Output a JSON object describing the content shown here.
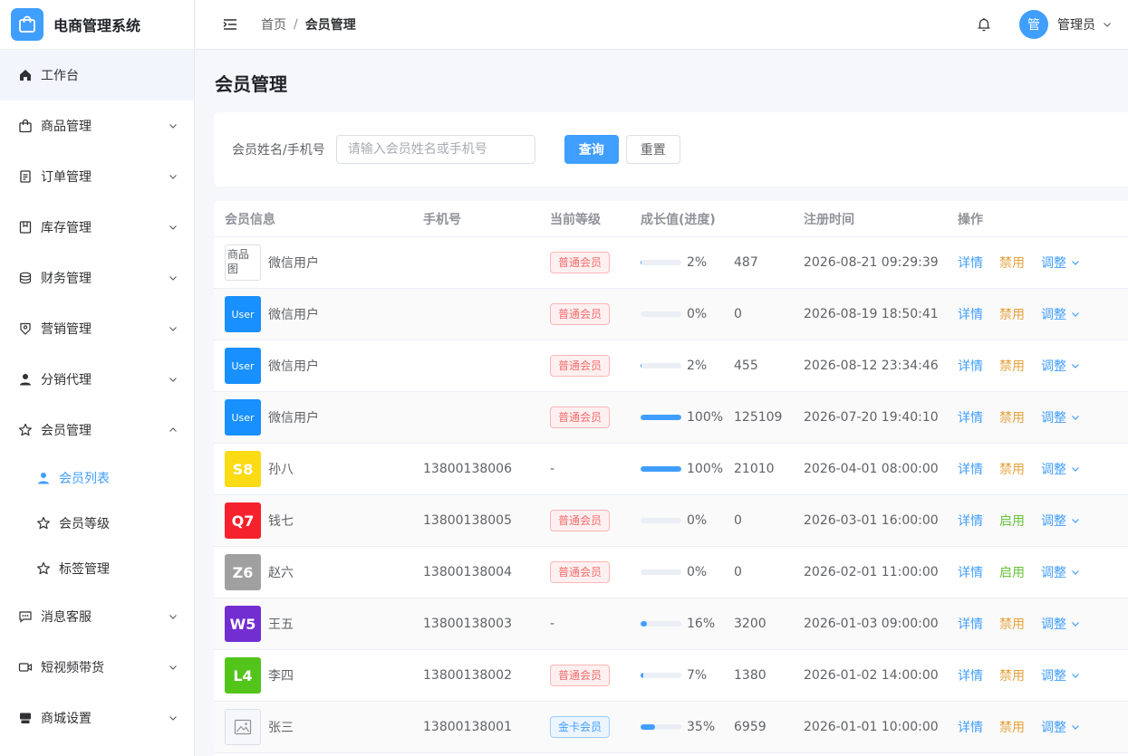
{
  "brand": {
    "title": "电商管理系统"
  },
  "colors": {
    "primary": "#409eff",
    "warning": "#e6a23c",
    "success": "#67c23a",
    "danger": "#f56c6c"
  },
  "sidebar": {
    "items": [
      {
        "label": "工作台",
        "icon": "home-icon"
      },
      {
        "label": "商品管理",
        "icon": "shopping-bag-icon"
      },
      {
        "label": "订单管理",
        "icon": "document-icon"
      },
      {
        "label": "库存管理",
        "icon": "box-icon"
      },
      {
        "label": "财务管理",
        "icon": "coins-icon"
      },
      {
        "label": "营销管理",
        "icon": "discount-icon"
      },
      {
        "label": "分销代理",
        "icon": "user-icon"
      },
      {
        "label": "会员管理",
        "icon": "star-icon"
      },
      {
        "label": "消息客服",
        "icon": "chat-icon"
      },
      {
        "label": "短视频带货",
        "icon": "video-icon"
      },
      {
        "label": "商城设置",
        "icon": "shop-icon"
      }
    ],
    "member_sub": [
      {
        "label": "会员列表",
        "icon": "user-icon"
      },
      {
        "label": "会员等级",
        "icon": "star-icon"
      },
      {
        "label": "标签管理",
        "icon": "star-icon"
      }
    ]
  },
  "header": {
    "breadcrumb_home": "首页",
    "breadcrumb_sep": "/",
    "breadcrumb_current": "会员管理",
    "avatar_text": "管",
    "user_name": "管理员"
  },
  "main": {
    "title": "会员管理",
    "search": {
      "label": "会员姓名/手机号",
      "placeholder": "请输入会员姓名或手机号",
      "query_label": "查询",
      "reset_label": "重置"
    },
    "table": {
      "headers": [
        "会员信息",
        "手机号",
        "当前等级",
        "成长值(进度)",
        "注册时间",
        "操作"
      ],
      "ops": {
        "detail": "详情",
        "adjust": "调整"
      },
      "rows": [
        {
          "avatar_type": "broken",
          "avatar_text": "商品图",
          "avatar_color": "",
          "name": "微信用户",
          "phone": "",
          "level": "普通会员",
          "level_color": "red",
          "progress": 2,
          "progress_label": "2%",
          "growth": "487",
          "registered": "2026-08-21 09:29:39",
          "status_action": "禁用",
          "status_color": "orange"
        },
        {
          "avatar_type": "text",
          "avatar_text": "User",
          "avatar_color": "#1890ff",
          "name": "微信用户",
          "phone": "",
          "level": "普通会员",
          "level_color": "red",
          "progress": 0,
          "progress_label": "0%",
          "growth": "0",
          "registered": "2026-08-19 18:50:41",
          "status_action": "禁用",
          "status_color": "orange"
        },
        {
          "avatar_type": "text",
          "avatar_text": "User",
          "avatar_color": "#1890ff",
          "name": "微信用户",
          "phone": "",
          "level": "普通会员",
          "level_color": "red",
          "progress": 2,
          "progress_label": "2%",
          "growth": "455",
          "registered": "2026-08-12 23:34:46",
          "status_action": "禁用",
          "status_color": "orange"
        },
        {
          "avatar_type": "text",
          "avatar_text": "User",
          "avatar_color": "#1890ff",
          "name": "微信用户",
          "phone": "",
          "level": "普通会员",
          "level_color": "red",
          "progress": 100,
          "progress_label": "100%",
          "growth": "125109",
          "registered": "2026-07-20 19:40:10",
          "status_action": "禁用",
          "status_color": "orange"
        },
        {
          "avatar_type": "text",
          "avatar_text": "S8",
          "avatar_color": "#fadb14",
          "name": "孙八",
          "phone": "13800138006",
          "level": "-",
          "level_color": "",
          "progress": 100,
          "progress_label": "100%",
          "growth": "21010",
          "registered": "2026-04-01 08:00:00",
          "status_action": "禁用",
          "status_color": "orange"
        },
        {
          "avatar_type": "text",
          "avatar_text": "Q7",
          "avatar_color": "#f5222d",
          "name": "钱七",
          "phone": "13800138005",
          "level": "普通会员",
          "level_color": "red",
          "progress": 0,
          "progress_label": "0%",
          "growth": "0",
          "registered": "2026-03-01 16:00:00",
          "status_action": "启用",
          "status_color": "green"
        },
        {
          "avatar_type": "text",
          "avatar_text": "Z6",
          "avatar_color": "#a0a0a0",
          "name": "赵六",
          "phone": "13800138004",
          "level": "普通会员",
          "level_color": "red",
          "progress": 0,
          "progress_label": "0%",
          "growth": "0",
          "registered": "2026-02-01 11:00:00",
          "status_action": "启用",
          "status_color": "green"
        },
        {
          "avatar_type": "text",
          "avatar_text": "W5",
          "avatar_color": "#722ed1",
          "name": "王五",
          "phone": "13800138003",
          "level": "-",
          "level_color": "",
          "progress": 16,
          "progress_label": "16%",
          "growth": "3200",
          "registered": "2026-01-03 09:00:00",
          "status_action": "禁用",
          "status_color": "orange"
        },
        {
          "avatar_type": "text",
          "avatar_text": "L4",
          "avatar_color": "#52c41a",
          "name": "李四",
          "phone": "13800138002",
          "level": "普通会员",
          "level_color": "red",
          "progress": 7,
          "progress_label": "7%",
          "growth": "1380",
          "registered": "2026-01-02 14:00:00",
          "status_action": "禁用",
          "status_color": "orange"
        },
        {
          "avatar_type": "placeholder",
          "avatar_text": "",
          "avatar_color": "",
          "name": "张三",
          "phone": "13800138001",
          "level": "金卡会员",
          "level_color": "blue",
          "progress": 35,
          "progress_label": "35%",
          "growth": "6959",
          "registered": "2026-01-01 10:00:00",
          "status_action": "禁用",
          "status_color": "orange"
        }
      ]
    }
  }
}
